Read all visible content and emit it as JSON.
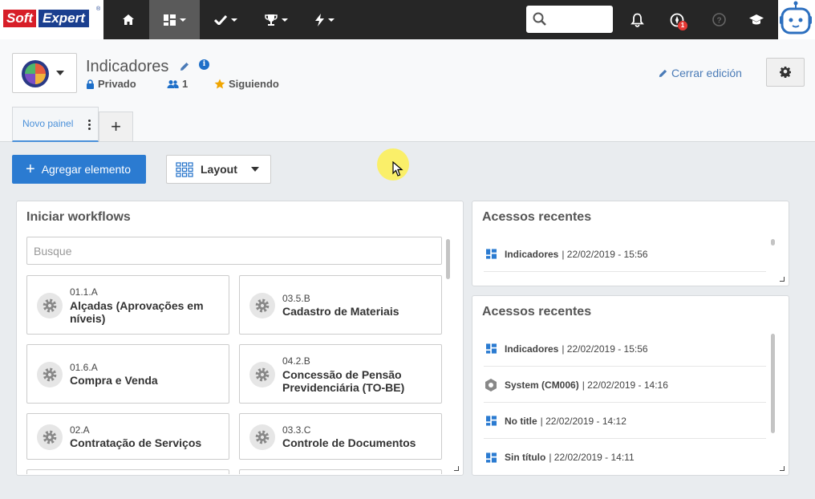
{
  "logo": {
    "part1": "Soft",
    "part2": "Expert",
    "registered": "®"
  },
  "nav": {
    "items": [
      {
        "icon": "home-icon"
      },
      {
        "icon": "dashboard-icon",
        "active": true
      },
      {
        "icon": "check-icon"
      },
      {
        "icon": "trophy-icon"
      },
      {
        "icon": "bolt-icon"
      }
    ],
    "search_placeholder": "",
    "notification_badge": "1",
    "colors": {
      "bar": "#262626",
      "active": "#5a5a5a"
    }
  },
  "header": {
    "title": "Indicadores",
    "info": "i",
    "privacy": "Privado",
    "members": "1",
    "following": "Siguiendo",
    "close_edit": "Cerrar edición"
  },
  "tabs": {
    "active_label": "Novo painel",
    "add_label": "+"
  },
  "toolbar": {
    "add_label": "Agregar elemento",
    "add_plus": "+",
    "layout_label": "Layout"
  },
  "workflows": {
    "title": "Iniciar workflows",
    "search_placeholder": "Busque",
    "items": [
      {
        "code": "01.1.A",
        "name": "Alçadas (Aprovações em níveis)"
      },
      {
        "code": "03.5.B",
        "name": "Cadastro de Materiais"
      },
      {
        "code": "01.6.A",
        "name": "Compra e Venda"
      },
      {
        "code": "04.2.B",
        "name": "Concessão de Pensão Previdenciária (TO-BE)"
      },
      {
        "code": "02.A",
        "name": "Contratação de Serviços"
      },
      {
        "code": "03.3.C",
        "name": "Controle de Documentos"
      }
    ]
  },
  "recent1": {
    "title": "Acessos recentes",
    "items": [
      {
        "icon": "dashboard-icon",
        "name": "Indicadores",
        "date": "| 22/02/2019 - 15:56"
      }
    ]
  },
  "recent2": {
    "title": "Acessos recentes",
    "items": [
      {
        "icon": "dashboard-icon",
        "name": "Indicadores",
        "date": "| 22/02/2019 - 15:56"
      },
      {
        "icon": "system-icon",
        "name": "System (CM006)",
        "date": "| 22/02/2019 - 14:16"
      },
      {
        "icon": "dashboard-icon",
        "name": "No title",
        "date": "| 22/02/2019 - 14:12"
      },
      {
        "icon": "dashboard-icon",
        "name": "Sin título",
        "date": "| 22/02/2019 - 14:11"
      }
    ]
  },
  "colors": {
    "primary": "#2b7bd1",
    "link": "#4a7bb7",
    "star": "#f0a500",
    "lock": "#1e6fc8"
  }
}
